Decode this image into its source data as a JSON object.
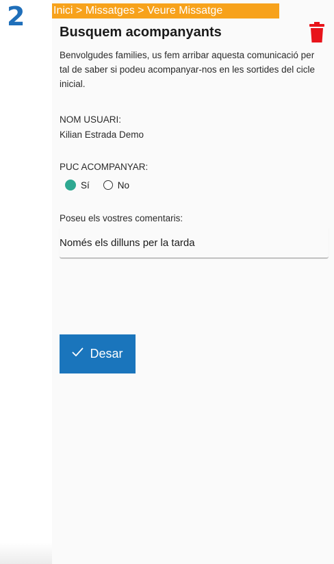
{
  "step_number": "2",
  "breadcrumb": "Inici > Missatges > Veure Missatge",
  "message": {
    "title": "Busquem acompanyants",
    "description": "Benvolgudes families, us fem arribar aquesta comunicació per tal de saber si podeu acompanyar-nos en les sortides del cicle inicial."
  },
  "user_field": {
    "label": "NOM USUARI:",
    "value": "Kilian Estrada Demo"
  },
  "accompany_field": {
    "label": "PUC ACOMPANYAR:",
    "options": [
      {
        "label": "Sí",
        "selected": true
      },
      {
        "label": "No",
        "selected": false
      }
    ]
  },
  "comments_field": {
    "label": "Poseu els vostres comentaris:",
    "value": "Només els dilluns per la tarda"
  },
  "save_button": {
    "label": "Desar"
  },
  "icons": {
    "trash": "trash-icon",
    "check": "check-icon"
  },
  "colors": {
    "breadcrumb_bg": "#f7a21b",
    "button_bg": "#1a75bc",
    "trash": "#e8141b",
    "radio_selected": "#2ea891",
    "step_number": "#1f6fba"
  }
}
